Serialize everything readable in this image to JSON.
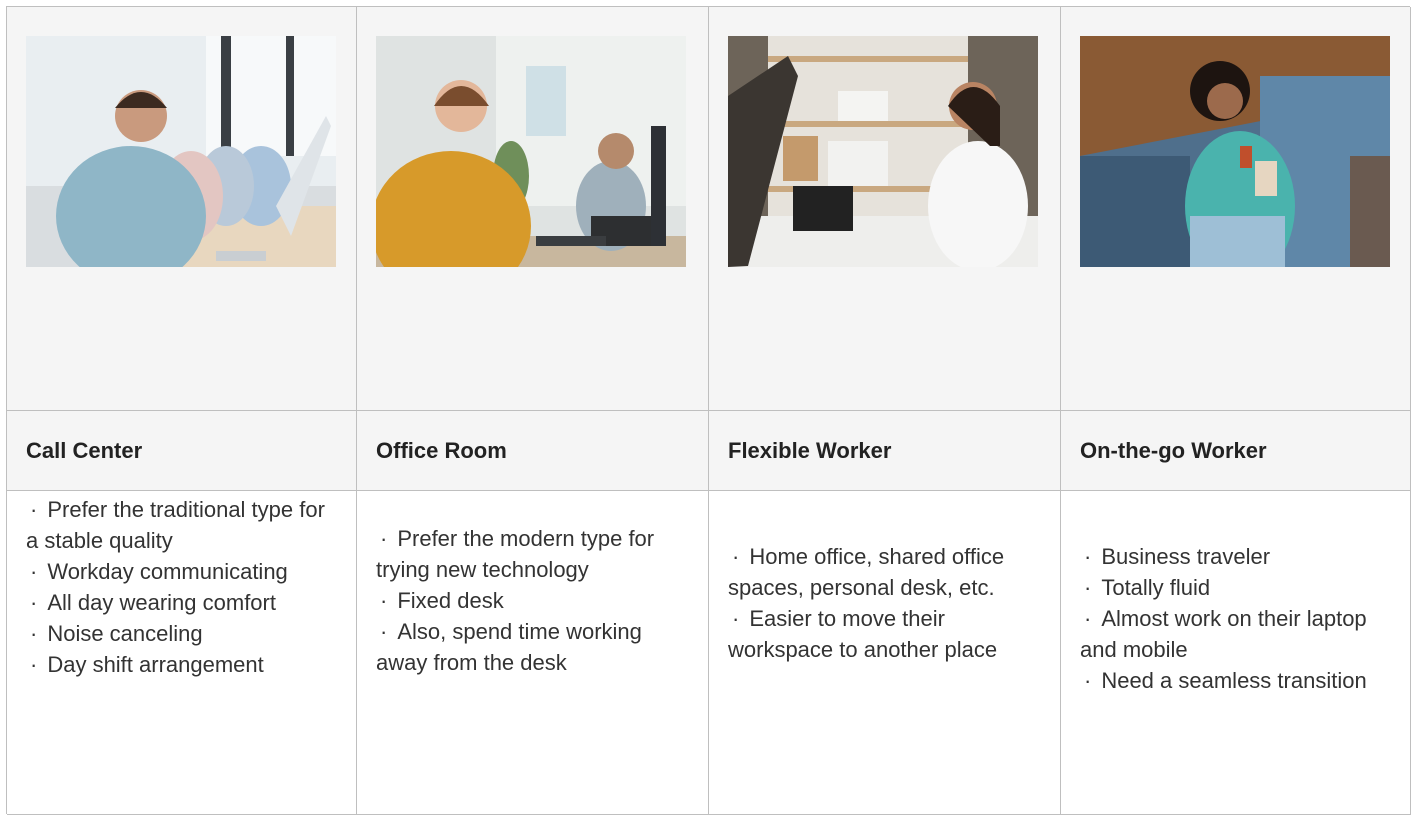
{
  "columns": [
    {
      "title": "Call Center",
      "image": "call-center-photo",
      "items": [
        "Prefer the traditional type for a stable quality",
        "Workday communicating",
        "All day wearing comfort",
        "Noise canceling",
        "Day shift arrangement"
      ]
    },
    {
      "title": "Office Room",
      "image": "office-room-photo",
      "items": [
        "Prefer the modern type for trying new technology",
        "Fixed desk",
        "Also, spend time working away from the desk"
      ]
    },
    {
      "title": "Flexible Worker",
      "image": "flexible-worker-photo",
      "items": [
        "Home office, shared office spaces, personal desk, etc.",
        "Easier to move their workspace to another place"
      ]
    },
    {
      "title": "On-the-go Worker",
      "image": "on-the-go-worker-photo",
      "items": [
        "Business traveler",
        "Totally fluid",
        "Almost work on their laptop and mobile",
        "Need a seamless transition"
      ]
    }
  ],
  "bullet_char": "·",
  "colors": {
    "border": "#bfbfbf",
    "header_bg": "#f5f5f5",
    "text": "#333333"
  }
}
